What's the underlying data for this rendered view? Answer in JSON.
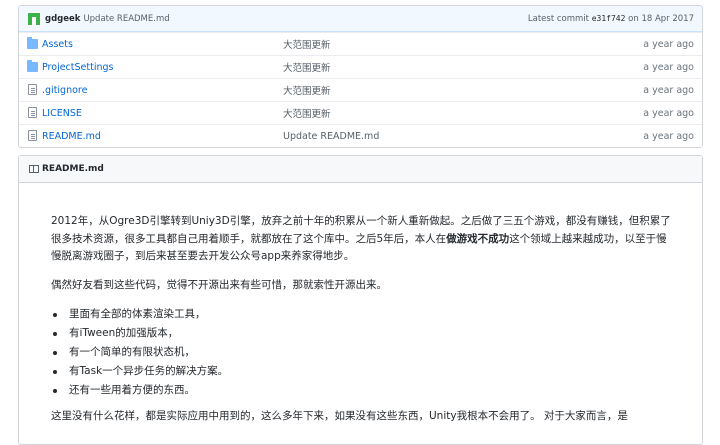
{
  "commit": {
    "author": "gdgeek",
    "message": "Update README.md",
    "latest_label": "Latest commit",
    "sha": "e31f742",
    "on_label": "on",
    "date": "18 Apr 2017"
  },
  "files": [
    {
      "type": "folder",
      "name": "Assets",
      "message": "大范围更新",
      "age": "a year ago"
    },
    {
      "type": "folder",
      "name": "ProjectSettings",
      "message": "大范围更新",
      "age": "a year ago"
    },
    {
      "type": "file",
      "name": ".gitignore",
      "message": "大范围更新",
      "age": "a year ago"
    },
    {
      "type": "file",
      "name": "LICENSE",
      "message": "大范围更新",
      "age": "a year ago"
    },
    {
      "type": "file",
      "name": "README.md",
      "message": "Update README.md",
      "age": "a year ago"
    }
  ],
  "readme": {
    "title": "README.md",
    "p1_before": "2012年，从Ogre3D引擎转到Uniy3D引擎，放弃之前十年的积累从一个新人重新做起。之后做了三五个游戏，都没有赚钱，但积累了很多技术资源，很多工具都自己用着顺手，就都放在了这个库中。之后5年后，本人在",
    "p1_bold": "做游戏不成功",
    "p1_after": "这个领域上越来越成功，以至于慢慢脱离游戏圈子，到后来甚至要去开发公众号app来养家得地步。",
    "p2": "偶然好友看到这些代码，觉得不开源出来有些可惜，那就索性开源出来。",
    "list": [
      "里面有全部的体素渲染工具，",
      "有iTween的加强版本，",
      "有一个简单的有限状态机，",
      "有Task一个异步任务的解决方案。",
      "还有一些用着方便的东西。"
    ],
    "p3": "这里没有什么花样，都是实际应用中用到的，这么多年下来，如果没有这些东西，Unity我根本不会用了。 对于大家而言，是"
  }
}
